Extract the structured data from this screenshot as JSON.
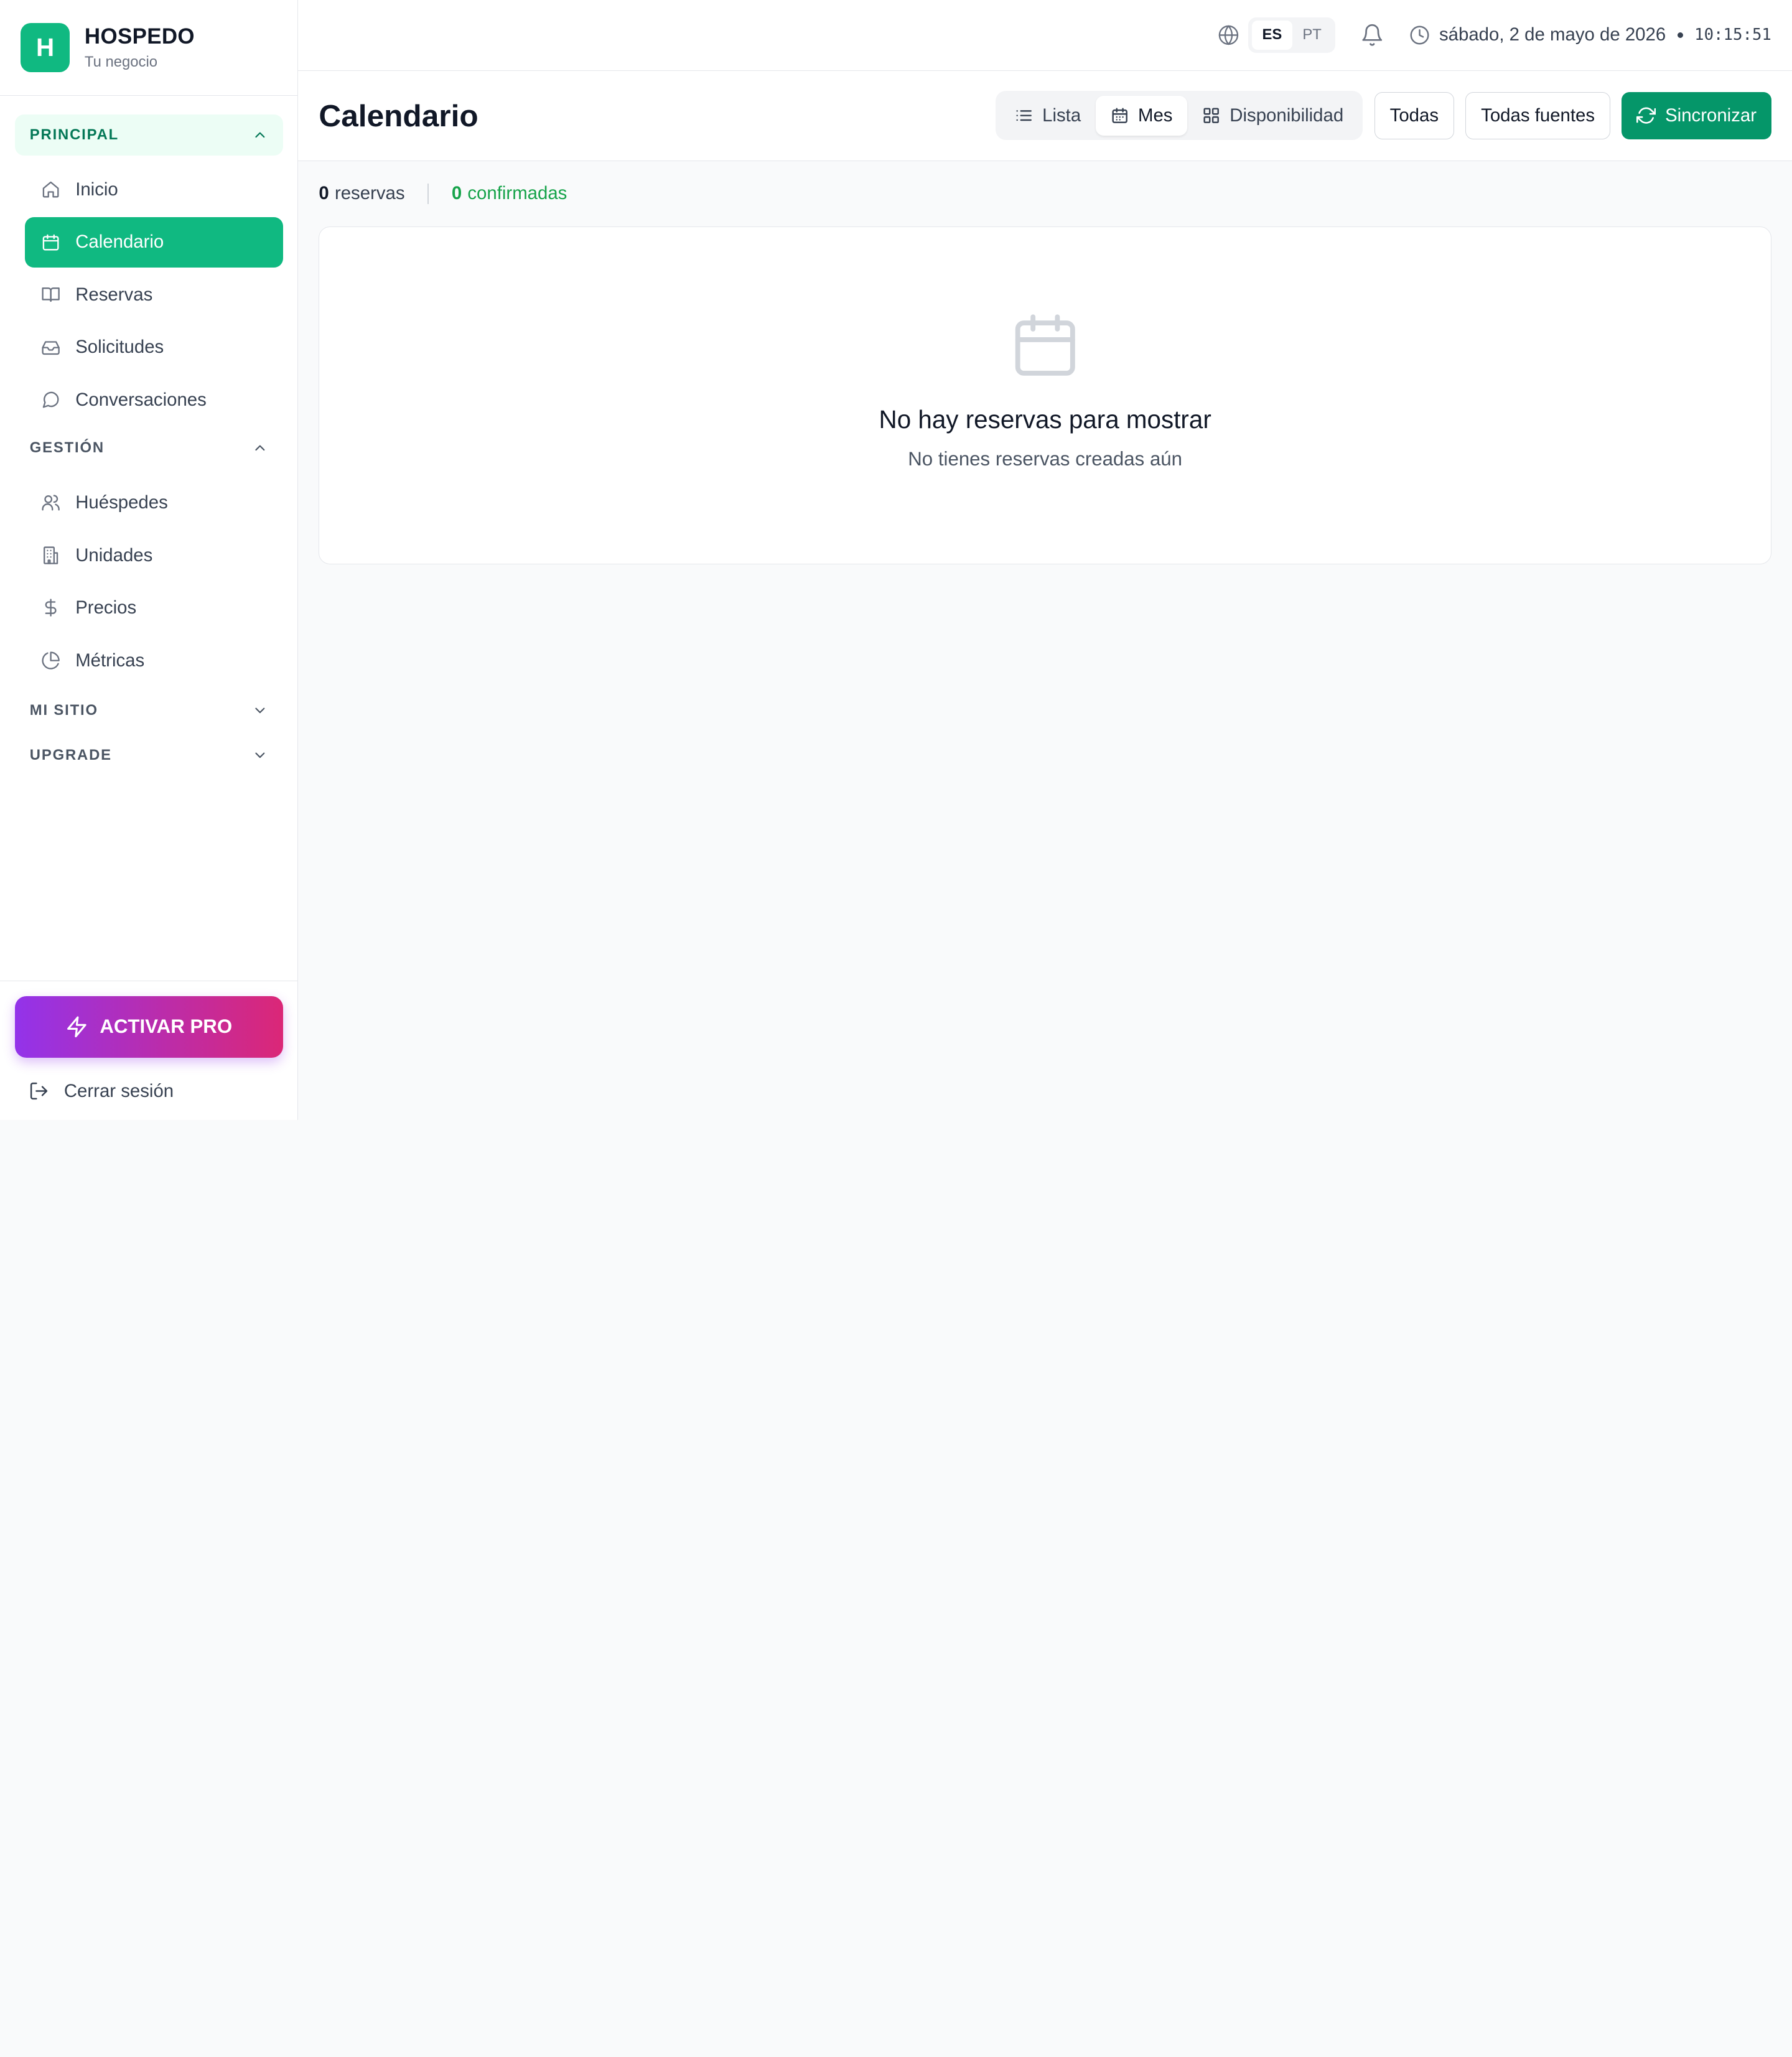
{
  "brand": {
    "logo_letter": "H",
    "name": "HOSPEDO",
    "subtitle": "Tu negocio"
  },
  "colors": {
    "accent": "#10b981",
    "accent_dark": "#059669",
    "pro_start": "#9333ea",
    "pro_end": "#db2777"
  },
  "sidebar": {
    "sections": [
      {
        "title": "PRINCIPAL",
        "items": [
          {
            "label": "Inicio",
            "icon": "home-icon"
          },
          {
            "label": "Calendario",
            "icon": "calendar-icon"
          },
          {
            "label": "Reservas",
            "icon": "book-icon"
          },
          {
            "label": "Solicitudes",
            "icon": "inbox-icon"
          },
          {
            "label": "Conversaciones",
            "icon": "message-icon"
          }
        ]
      },
      {
        "title": "GESTIÓN",
        "items": [
          {
            "label": "Huéspedes",
            "icon": "users-icon"
          },
          {
            "label": "Unidades",
            "icon": "building-icon"
          },
          {
            "label": "Precios",
            "icon": "dollar-icon"
          },
          {
            "label": "Métricas",
            "icon": "pie-chart-icon"
          }
        ]
      },
      {
        "title": "MI SITIO",
        "items": []
      },
      {
        "title": "UPGRADE",
        "items": []
      }
    ],
    "active_item": "Calendario",
    "pro_label": "ACTIVAR PRO",
    "logout_label": "Cerrar sesión"
  },
  "topbar": {
    "languages": [
      "ES",
      "PT"
    ],
    "selected_language": "ES",
    "date": "sábado, 2 de mayo de 2026",
    "time": "10:15:51"
  },
  "header": {
    "title": "Calendario",
    "views": [
      {
        "label": "Lista",
        "icon": "list-icon"
      },
      {
        "label": "Mes",
        "icon": "calendar-icon"
      },
      {
        "label": "Disponibilidad",
        "icon": "grid-icon"
      }
    ],
    "selected_view": "Mes",
    "filter_status": "Todas",
    "filter_source": "Todas fuentes",
    "sync_label": "Sincronizar"
  },
  "stats": {
    "reservations_count": "0",
    "reservations_label": "reservas",
    "confirmed_count": "0",
    "confirmed_label": "confirmadas"
  },
  "empty_state": {
    "icon": "calendar-icon",
    "title": "No hay reservas para mostrar",
    "subtitle": "No tienes reservas creadas aún"
  }
}
